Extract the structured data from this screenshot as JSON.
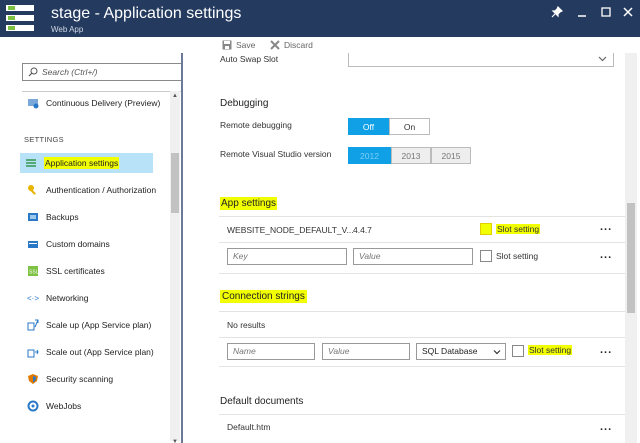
{
  "window": {
    "title": "stage - Application settings",
    "subtitle": "Web App",
    "icons": [
      "pin-icon",
      "minimize-icon",
      "maximize-icon",
      "close-icon"
    ]
  },
  "toolbar": {
    "save_label": "Save",
    "discard_label": "Discard"
  },
  "sidebar": {
    "search_placeholder": "Search (Ctrl+/)",
    "section_header": "SETTINGS",
    "top_item": "Continuous Delivery (Preview)",
    "items": [
      {
        "label": "Application settings",
        "icon": "app-settings-icon"
      },
      {
        "label": "Authentication / Authorization",
        "icon": "key-icon"
      },
      {
        "label": "Backups",
        "icon": "backup-icon"
      },
      {
        "label": "Custom domains",
        "icon": "domain-icon"
      },
      {
        "label": "SSL certificates",
        "icon": "certificate-icon"
      },
      {
        "label": "Networking",
        "icon": "network-icon"
      },
      {
        "label": "Scale up (App Service plan)",
        "icon": "scale-up-icon"
      },
      {
        "label": "Scale out (App Service plan)",
        "icon": "scale-out-icon"
      },
      {
        "label": "Security scanning",
        "icon": "shield-icon"
      },
      {
        "label": "WebJobs",
        "icon": "webjobs-icon"
      }
    ]
  },
  "main": {
    "auto_swap_label": "Auto Swap Slot",
    "debugging": {
      "title": "Debugging",
      "remote_debugging_label": "Remote debugging",
      "remote_debugging_options": [
        "Off",
        "On"
      ],
      "remote_debugging_selected": "Off",
      "vs_version_label": "Remote Visual Studio version",
      "vs_versions": [
        "2012",
        "2013",
        "2015"
      ],
      "vs_selected": "2012"
    },
    "app_settings": {
      "title": "App settings",
      "rows": [
        {
          "key": "WEBSITE_NODE_DEFAULT_V...",
          "value": "4.4.7",
          "slot_label": "Slot setting"
        }
      ],
      "new_row": {
        "key_placeholder": "Key",
        "value_placeholder": "Value",
        "slot_label": "Slot setting"
      },
      "more": "..."
    },
    "connection_strings": {
      "title": "Connection strings",
      "empty_text": "No results",
      "new_row": {
        "name_placeholder": "Name",
        "value_placeholder": "Value",
        "type_selected": "SQL Database",
        "slot_label": "Slot setting"
      },
      "more": "..."
    },
    "default_documents": {
      "title": "Default documents",
      "rows": [
        "Default.htm"
      ],
      "more": "..."
    }
  },
  "colors": {
    "header": "#243a5e",
    "accent": "#0fa0e6",
    "highlight": "#f2ff00",
    "active_nav": "#b7e2f7"
  }
}
